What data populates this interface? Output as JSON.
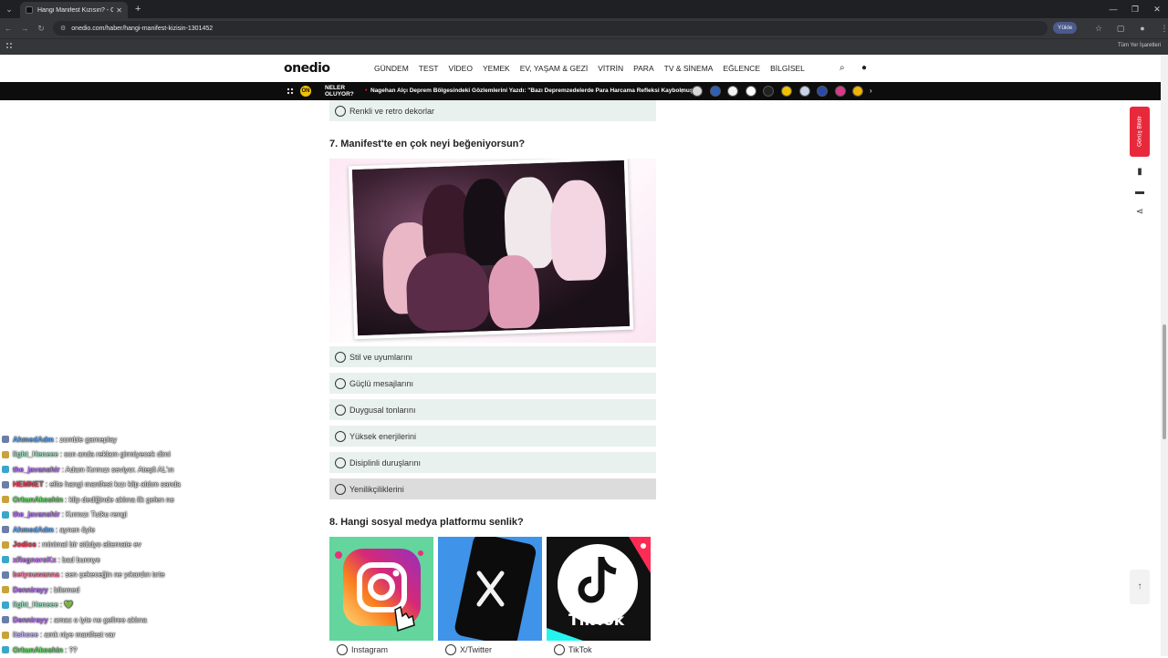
{
  "browser": {
    "tab_title": "Hangi Manifest Kızısın? - Oned",
    "url": "onedio.com/haber/hangi-manifest-kizisin-1301452",
    "upload_label": "Yükle",
    "all_bookmarks": "Tüm Yer İşaretleri"
  },
  "site": {
    "logo": "onedio",
    "nav": [
      "GÜNDEM",
      "TEST",
      "VİDEO",
      "YEMEK",
      "EV, YAŞAM & GEZİ",
      "VİTRİN",
      "PARA",
      "TV & SİNEMA",
      "EĞLENCE",
      "BİLGİSEL"
    ]
  },
  "ticker": {
    "badge": "ON",
    "neler_line1": "NELER",
    "neler_line2": "OLUYOR?",
    "headline": "Nagehan Alçı Deprem Bölgesindeki Gözlemlerini Yazdı: \"Bazı Depremzedelerde Para Harcama Refleksi Kaybolmuş\""
  },
  "quiz": {
    "prev_option": "Renkli ve retro dekorlar",
    "q7_title": "7. Manifest'te en çok neyi beğeniyorsun?",
    "q7_options": [
      "Stil ve uyumlarını",
      "Güçlü mesajlarını",
      "Duygusal tonlarını",
      "Yüksek enerjilerini",
      "Disiplinli duruşlarını",
      "Yenilikçiliklerini"
    ],
    "q8_title": "8. Hangi sosyal medya platformu senlik?",
    "q8_options": [
      "Instagram",
      "X/Twitter",
      "TikTok"
    ],
    "tiktok_wordmark": "TikTok"
  },
  "side": {
    "feedback": "Görüş Bildir"
  },
  "chat": [
    {
      "name": "AhmedAdm",
      "color": "#5aa9ff",
      "msg": ": zombie gameplay"
    },
    {
      "name": "light_Heneee",
      "color": "#9fe6c2",
      "msg": ": son anda reklam girmiyecek dimi"
    },
    {
      "name": "the_javanshir",
      "color": "#b66dff",
      "msg": ": Adam Kırmızı seviyor. Ateşli AL'ın"
    },
    {
      "name": "HEMNET",
      "color": "#ff3355",
      "msg": ": elite hangi manifest kızı klip aldım sanda"
    },
    {
      "name": "OrkunAkoshin",
      "color": "#55dd55",
      "msg": ": klip dediğinde aklına ilk gelen ne"
    },
    {
      "name": "the_javanshir",
      "color": "#b66dff",
      "msg": ": Kırmızı Tutku rengi"
    },
    {
      "name": "AhmedAdm",
      "color": "#5aa9ff",
      "msg": ": aynen öyle"
    },
    {
      "name": "Jodios",
      "color": "#ff3355",
      "msg": ": minimal bir stüdyo alternate ev"
    },
    {
      "name": "xRegnoroKx",
      "color": "#c66bff",
      "msg": ": bad bunnye"
    },
    {
      "name": "betyouwanna",
      "color": "#ff7aa2",
      "msg": ": sen çekeceğin ne yıkardın tırte"
    },
    {
      "name": "Dennirayy",
      "color": "#b666ff",
      "msg": ": bilemed"
    },
    {
      "name": "light_Heneee",
      "color": "#9fe6c2",
      "msg": ": 💚"
    },
    {
      "name": "Dennirayy",
      "color": "#b666ff",
      "msg": ": amac o iyte ne geliree aklına"
    },
    {
      "name": "itshoee",
      "color": "#c9b8ff",
      "msg": ": amk niye manifest var"
    },
    {
      "name": "OrkunAkoshin",
      "color": "#55dd55",
      "msg": ": ??"
    }
  ]
}
